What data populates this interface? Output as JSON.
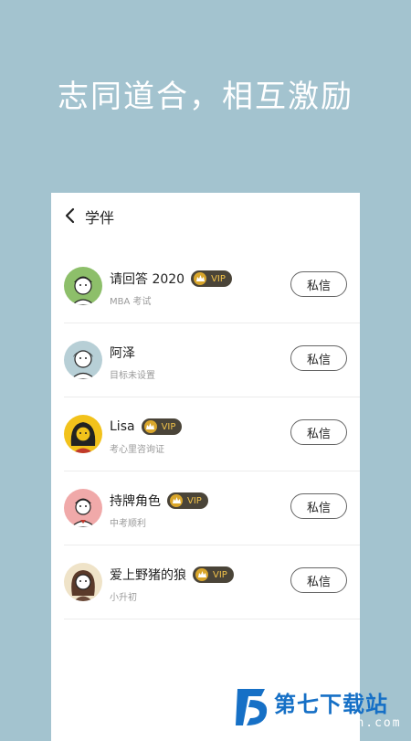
{
  "headline": "志同道合，相互激励",
  "nav": {
    "title": "学伴"
  },
  "vip_label": "VIP",
  "message_label": "私信",
  "users": [
    {
      "name": "请回答 2020",
      "vip": true,
      "goal": "MBA 考试",
      "avatar_bg": "#8dbf6a"
    },
    {
      "name": "阿泽",
      "vip": false,
      "goal": "目标未设置",
      "avatar_bg": "#b7cfd6"
    },
    {
      "name": "Lisa",
      "vip": true,
      "goal": "考心里咨询证",
      "avatar_bg": "#f2c21b"
    },
    {
      "name": "持牌角色",
      "vip": true,
      "goal": "中考顺利",
      "avatar_bg": "#f0a9a9"
    },
    {
      "name": "爱上野猪的狼",
      "vip": true,
      "goal": "小升初",
      "avatar_bg": "#efe3c8"
    }
  ],
  "watermark": {
    "name": "第七下载站",
    "url": "www.d7down.com"
  }
}
